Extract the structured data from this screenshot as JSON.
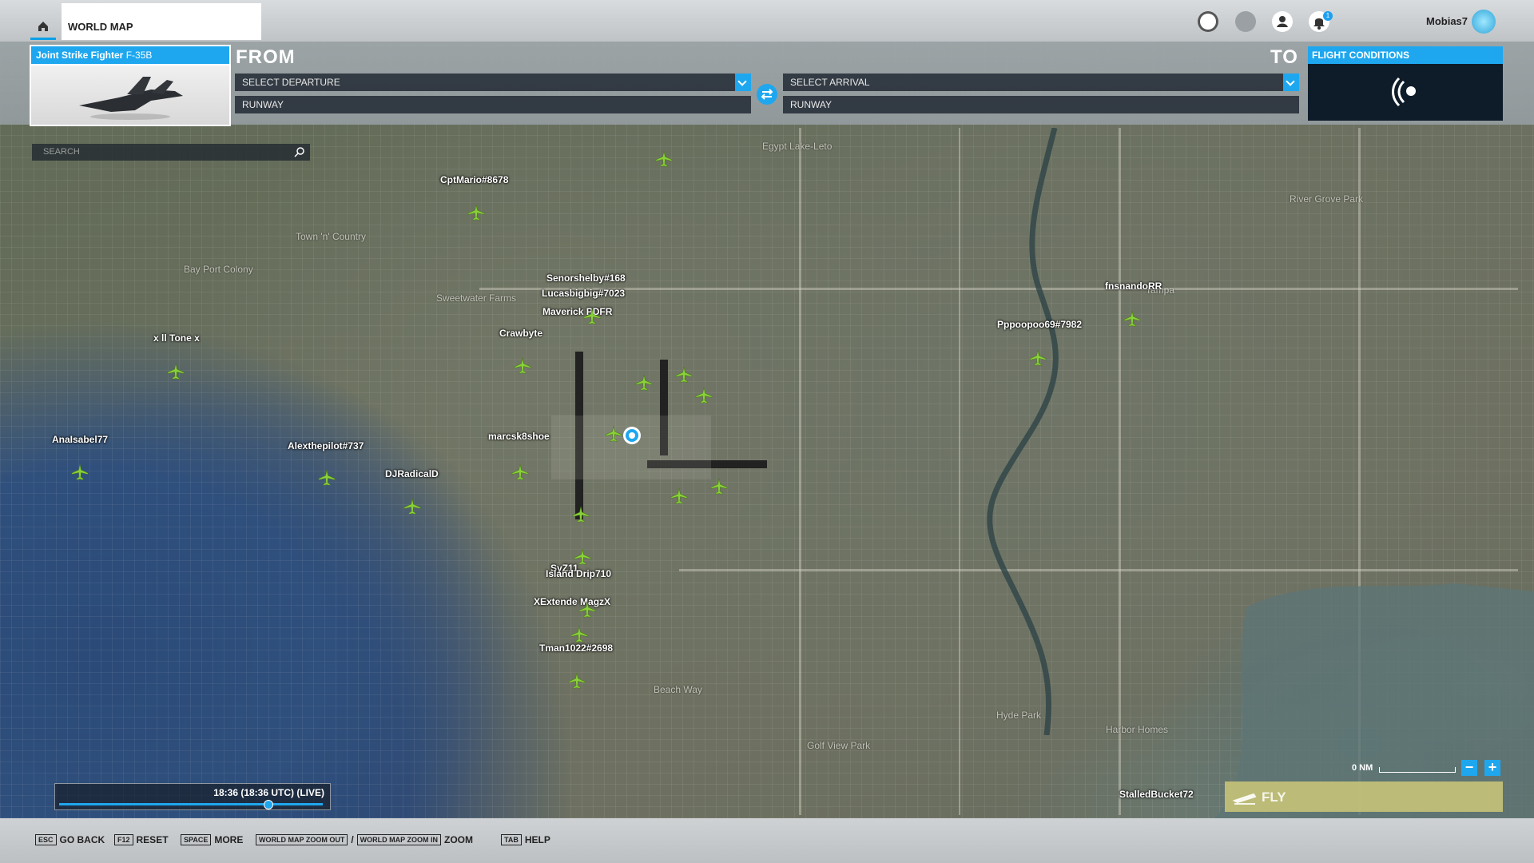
{
  "topbar": {
    "tab_label": "WORLD MAP",
    "username": "Mobias7",
    "notification_count": "1",
    "icons": [
      "home-icon",
      "activity-icon",
      "multiplayer-icon",
      "profile-icon",
      "notifications-icon",
      "rank-gem-icon"
    ]
  },
  "aircraft": {
    "brand": "Joint Strike Fighter",
    "model": "F-35B"
  },
  "planner": {
    "from_label": "FROM",
    "to_label": "TO",
    "departure_placeholder": "SELECT DEPARTURE",
    "arrival_placeholder": "SELECT ARRIVAL",
    "runway_from": "RUNWAY",
    "runway_to": "RUNWAY"
  },
  "flight_conditions": {
    "title": "FLIGHT CONDITIONS"
  },
  "search": {
    "placeholder": "SEARCH"
  },
  "time": {
    "label": "18:36 (18:36 UTC) (LIVE)",
    "progress": 0.79
  },
  "scale": {
    "label": "0 NM"
  },
  "zoom": {
    "minus": "−",
    "plus": "+"
  },
  "fly": {
    "label": "FLY"
  },
  "places": [
    "Egypt Lake-Leto",
    "River Grove Park",
    "Town 'n' Country",
    "Bay Port Colony",
    "Sweetwater Farms",
    "Tampa",
    "Beach Way",
    "Hyde Park",
    "Harbor Homes",
    "Golf View Park"
  ],
  "players": [
    "CptMario#8678",
    "x ll Tone x",
    "AnaIsabel77",
    "Alexthepilot#737",
    "DJRadicalD",
    "Senorshelby#168",
    "Lucasbigbig#7023",
    "Maverick PDFR",
    "Crawbyte",
    "fnsnandoRR",
    "Pppoopoo69#7982",
    "marcsk8shoe",
    "SyZ11",
    "Island Drip710",
    "XExtende MagzX",
    "Tman1022#2698",
    "StalledBucket72"
  ],
  "bottom_hints": [
    {
      "key": "ESC",
      "label": "GO BACK"
    },
    {
      "key": "F12",
      "label": "RESET"
    },
    {
      "key": "SPACE",
      "label": "MORE"
    },
    {
      "key": "WORLD MAP ZOOM OUT",
      "sep": "/",
      "key2": "WORLD MAP ZOOM IN",
      "label": "ZOOM"
    },
    {
      "key": "TAB",
      "label": "HELP"
    }
  ]
}
